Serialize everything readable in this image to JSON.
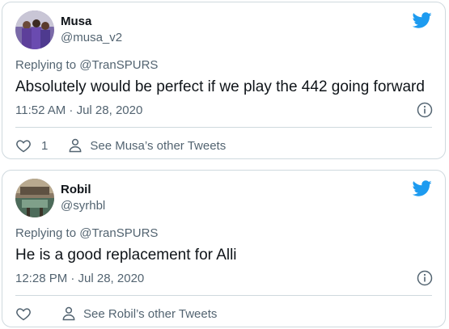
{
  "tweets": [
    {
      "name": "Musa",
      "handle": "@musa_v2",
      "replying_prefix": "Replying to ",
      "replying_to": "@TranSPURS",
      "text": "Absolutely would be perfect if we play the 442 going forward",
      "time": "11:52 AM · Jul 28, 2020",
      "likes": "1",
      "other_tweets_label": "See Musa’s other Tweets"
    },
    {
      "name": "Robil",
      "handle": "@syrhbl",
      "replying_prefix": "Replying to ",
      "replying_to": "@TranSPURS",
      "text": "He is a good replacement for Alli",
      "time": "12:28 PM · Jul 28, 2020",
      "likes": "",
      "other_tweets_label": "See Robil’s other Tweets"
    }
  ],
  "colors": {
    "twitter_blue": "#1d9bf0",
    "secondary_text": "#536471",
    "border": "#cfd9de"
  },
  "icons": [
    "twitter-bird-icon",
    "info-icon",
    "heart-icon",
    "person-icon"
  ]
}
